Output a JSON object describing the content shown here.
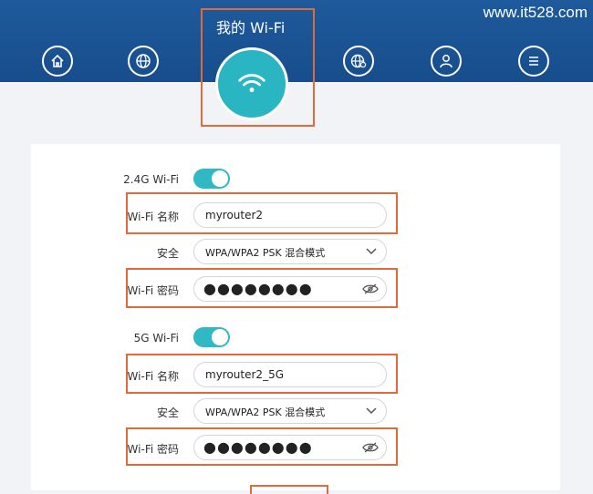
{
  "watermark": "www.it528.com",
  "header": {
    "wifi_title": "我的 Wi-Fi",
    "nav_icons": [
      "home-icon",
      "globe-icon",
      "wifi-icon",
      "globe-settings-icon",
      "user-icon",
      "menu-icon"
    ]
  },
  "band24": {
    "label": "2.4G Wi-Fi",
    "enabled": true,
    "name_label": "Wi-Fi 名称",
    "name_value": "myrouter2",
    "security_label": "安全",
    "security_value": "WPA/WPA2 PSK 混合模式",
    "password_label": "Wi-Fi 密码",
    "password_value": "●●●●●●●●"
  },
  "band5": {
    "label": "5G Wi-Fi",
    "enabled": true,
    "name_label": "Wi-Fi 名称",
    "name_value": "myrouter2_5G",
    "security_label": "安全",
    "security_value": "WPA/WPA2 PSK 混合模式",
    "password_label": "Wi-Fi 密码",
    "password_value": "●●●●●●●●"
  },
  "colors": {
    "header_blue": "#1e5a9c",
    "accent_teal": "#29b5c2",
    "highlight_red": "#e06a3a"
  }
}
